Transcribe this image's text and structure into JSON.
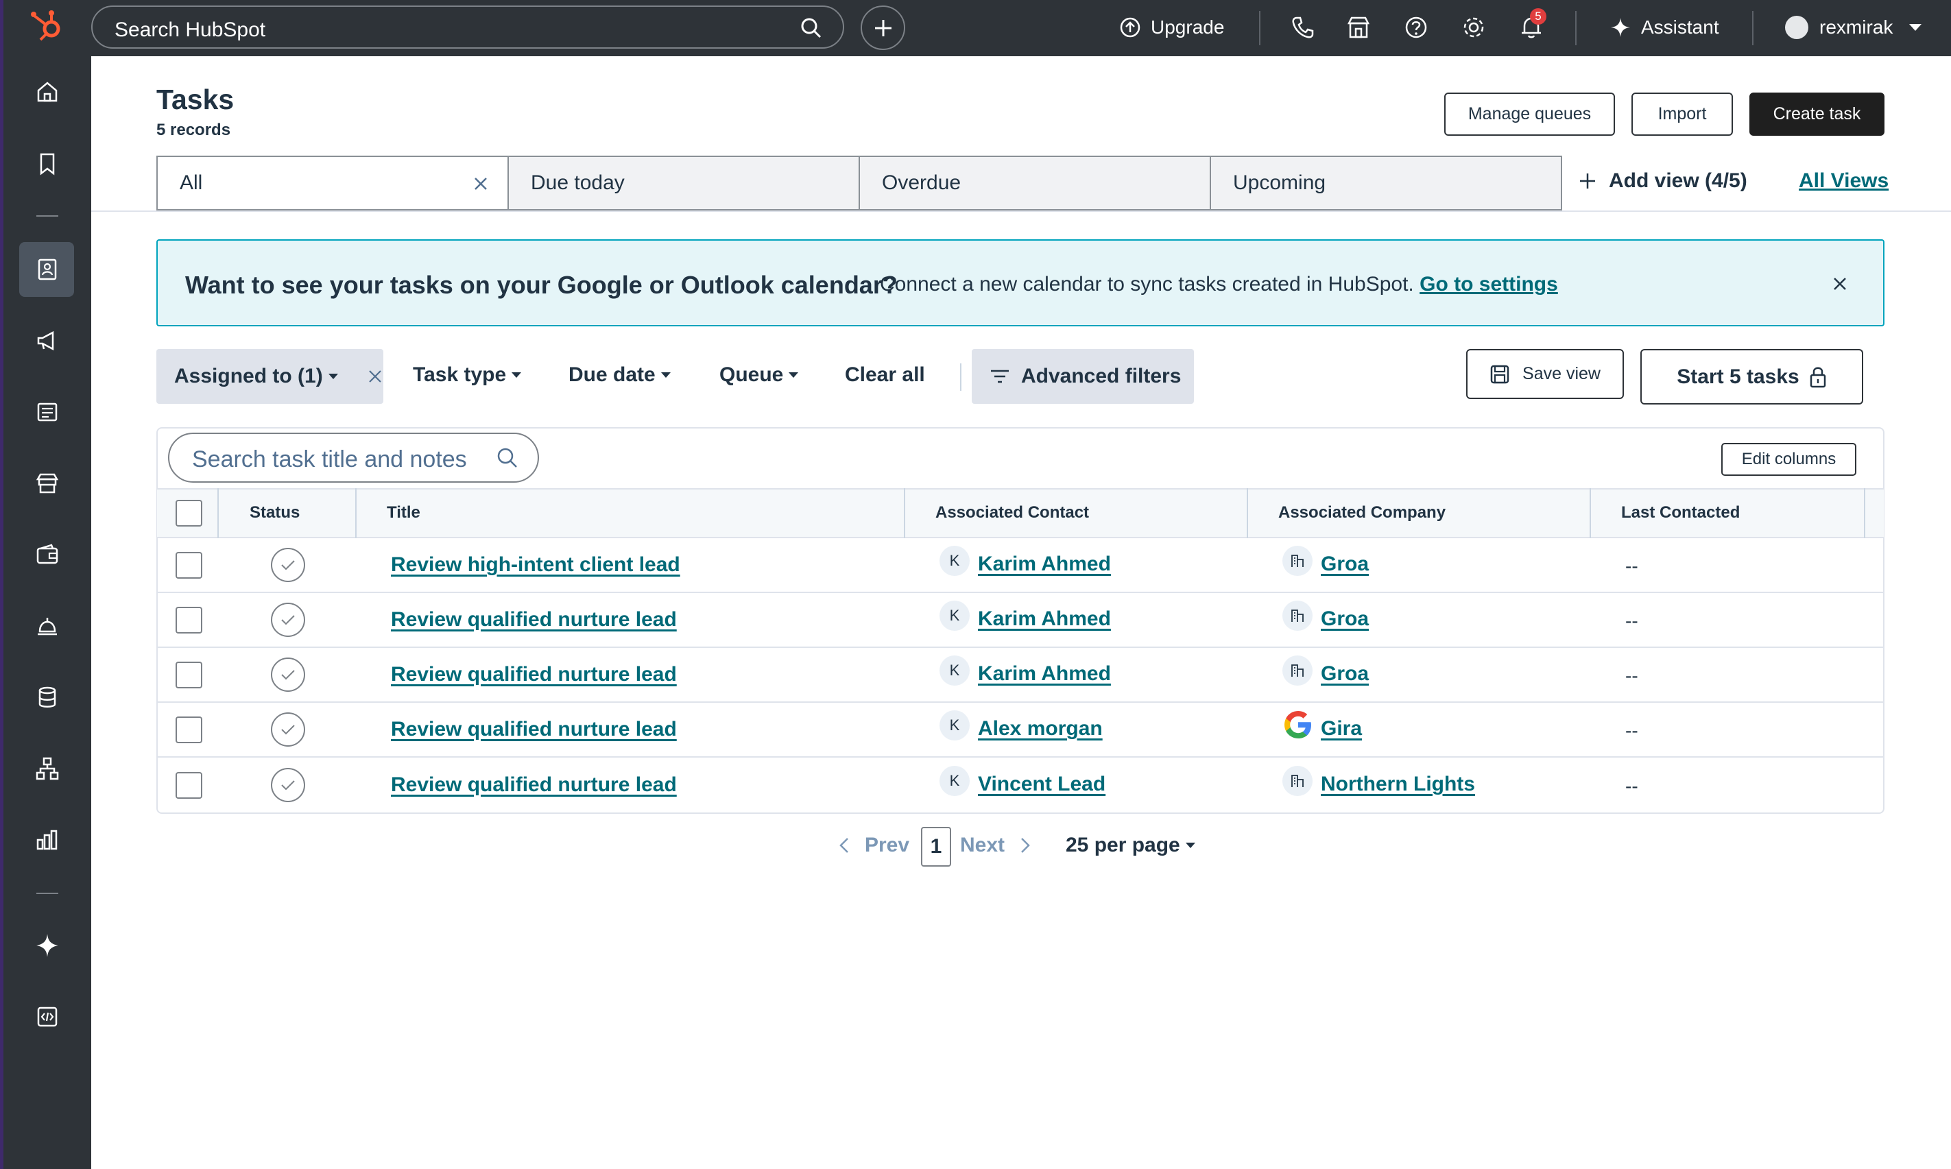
{
  "topbar": {
    "search_placeholder": "Search HubSpot",
    "upgrade_label": "Upgrade",
    "notification_count": "5",
    "assistant_label": "Assistant",
    "user_name": "rexmirak"
  },
  "page": {
    "title": "Tasks",
    "record_count": "5 records",
    "manage_queues_label": "Manage queues",
    "import_label": "Import",
    "create_task_label": "Create task"
  },
  "views": {
    "tabs": [
      {
        "label": "All",
        "active": true
      },
      {
        "label": "Due today",
        "active": false
      },
      {
        "label": "Overdue",
        "active": false
      },
      {
        "label": "Upcoming",
        "active": false
      }
    ],
    "add_view_label": "Add view (4/5)",
    "all_views_label": "All Views"
  },
  "banner": {
    "title": "Want to see your tasks on your Google or Outlook calendar?",
    "text": "Connect a new calendar to sync tasks created in HubSpot.",
    "link_label": "Go to settings"
  },
  "filters": {
    "assigned_label": "Assigned to (1)",
    "task_type_label": "Task type",
    "due_date_label": "Due date",
    "queue_label": "Queue",
    "clear_all_label": "Clear all",
    "advanced_label": "Advanced filters",
    "save_view_label": "Save view",
    "start_tasks_label": "Start 5 tasks"
  },
  "table": {
    "search_placeholder": "Search task title and notes",
    "edit_columns_label": "Edit columns",
    "columns": [
      "Status",
      "Title",
      "Associated Contact",
      "Associated Company",
      "Last Contacted"
    ],
    "rows": [
      {
        "title": "Review high-intent client lead",
        "contact_initial": "K",
        "contact": "Karim Ahmed",
        "company": "Groa",
        "company_icon": "building-icon",
        "last_contacted": "--"
      },
      {
        "title": "Review qualified nurture lead",
        "contact_initial": "K",
        "contact": "Karim Ahmed",
        "company": "Groa",
        "company_icon": "building-icon",
        "last_contacted": "--"
      },
      {
        "title": "Review qualified nurture lead",
        "contact_initial": "K",
        "contact": "Karim Ahmed",
        "company": "Groa",
        "company_icon": "building-icon",
        "last_contacted": "--"
      },
      {
        "title": "Review qualified nurture lead",
        "contact_initial": "K",
        "contact": "Alex morgan",
        "company": "Gira",
        "company_icon": "google-logo-icon",
        "last_contacted": "--"
      },
      {
        "title": "Review qualified nurture lead",
        "contact_initial": "K",
        "contact": "Vincent Lead",
        "company": "Northern Lights",
        "company_icon": "building-icon",
        "last_contacted": "--"
      }
    ]
  },
  "pagination": {
    "prev_label": "Prev",
    "current_page": "1",
    "next_label": "Next",
    "per_page_label": "25 per page"
  },
  "colors": {
    "topbar_bg": "#2e3338",
    "link": "#006a78",
    "banner_bg": "#e5f5f8",
    "banner_border": "#00a4bd",
    "hubspot_orange": "#ff5c35",
    "badge": "#e03e3e"
  }
}
